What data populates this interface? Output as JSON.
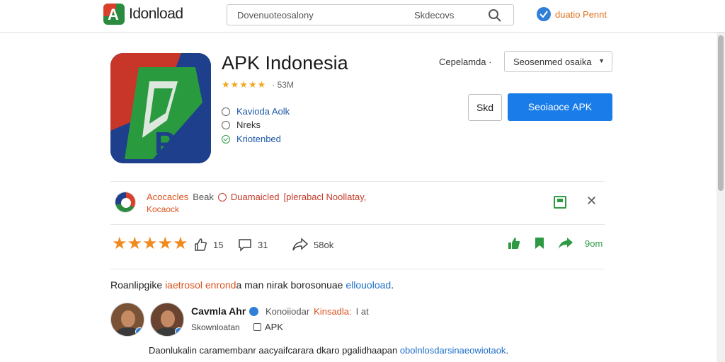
{
  "header": {
    "brand": "Idonload",
    "search_placeholder": "Dovenuoteosalony",
    "search_right_label": "Skdecovs",
    "promo_label": "duatio Pennt"
  },
  "app": {
    "title": "APK Indonesia",
    "stars": "★★★★★",
    "size": "· 53M",
    "features": [
      "Kavioda Aolk",
      "Nreks",
      "Kriotenbed"
    ],
    "icon_text": "PP"
  },
  "download": {
    "version_label": "Cepelamda ·",
    "version_select": "Seosenmed osaika",
    "secondary_button": "Skd",
    "primary_button": "Seoiaoce ΑPK"
  },
  "notice": {
    "part1": "Acocacles",
    "part2": "Beak",
    "part3": "Duamaicled",
    "part4": "[plerabacl Noollatay,",
    "line2": "Kocaock"
  },
  "actions": {
    "rating_stars": "★★★★★",
    "likes": "15",
    "comments": "31",
    "shares": "58ok",
    "views": "9om"
  },
  "description": {
    "part1": "Roanlipgike ",
    "part2": "iaetrosol enrond",
    "part3": "a man nirak borosonuae ",
    "part4": "ellouoload",
    "part5": "."
  },
  "author": {
    "name": "Cavmla Ahr",
    "meta1": "Konoiiodar",
    "meta2": "Kinsadla:",
    "meta3": "I at",
    "sub": "Skownloatan",
    "apk": "APK"
  },
  "footer": {
    "part1": "Daonlukalin caramembanr aacyaifcarara dkaro pgalidhaapan ",
    "part2": "obolnlosdarsinaeowiotaok",
    "part3": "."
  },
  "colors": {
    "accent_blue": "#1a7ce8",
    "orange": "#d9531e",
    "green": "#2e9a44",
    "star": "#f0a81f"
  }
}
